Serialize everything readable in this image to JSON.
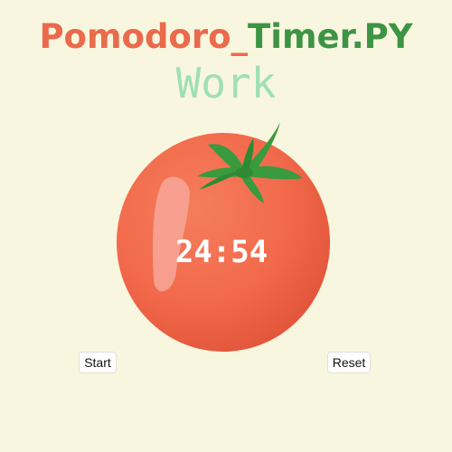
{
  "app": {
    "title_part_1": "Pomodoro_",
    "title_part_2": "Timer.PY",
    "mode_label": "Work"
  },
  "timer": {
    "display": "24:54"
  },
  "controls": {
    "start_label": "Start",
    "reset_label": "Reset"
  },
  "colors": {
    "background": "#f9f6df",
    "title_primary": "#ea6a4c",
    "title_secondary": "#3d9444",
    "mode_text": "#9fe0b2",
    "tomato_body": "#f26a4b",
    "tomato_leaf": "#3a9a3e",
    "timer_text": "#ffffff"
  },
  "icons": {
    "tomato": "tomato-icon"
  }
}
